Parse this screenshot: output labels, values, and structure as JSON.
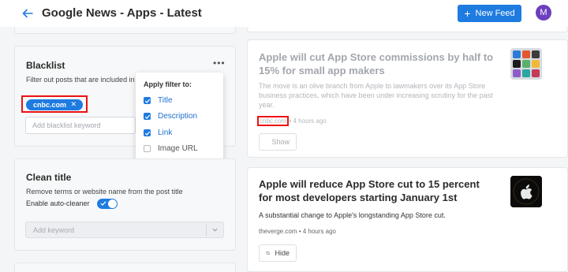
{
  "header": {
    "title": "Google News - Apps - Latest",
    "new_feed_label": "New Feed",
    "avatar_initial": "M",
    "accent_color": "#1e7be0"
  },
  "blacklist": {
    "title": "Blacklist",
    "description": "Filter out posts that are included in",
    "chip_label": "cnbc.com",
    "input_placeholder": "Add blacklist keyword",
    "apply_filter": {
      "title": "Apply filter to:",
      "options": [
        {
          "label": "Title",
          "checked": true
        },
        {
          "label": "Description",
          "checked": true
        },
        {
          "label": "Link",
          "checked": true
        },
        {
          "label": "Image URL",
          "checked": false
        }
      ]
    }
  },
  "clean_title": {
    "title": "Clean title",
    "description": "Remove terms or website name from the post title",
    "auto_cleaner_label": "Enable auto-cleaner",
    "auto_cleaner_enabled": true,
    "keyword_placeholder": "Add keyword"
  },
  "feed": {
    "items": [
      {
        "title": "Apple will cut App Store commissions by half to 15% for small app makers",
        "description": "The move is an olive branch from Apple to lawmakers over its App Store business practices, which have been under increasing scrutiny for the past year.",
        "source": "cnbc.com",
        "time": "4 hours ago",
        "button_label": "Show",
        "hidden": true
      },
      {
        "title": "Apple will reduce App Store cut to 15 percent for most developers starting January 1st",
        "description": "A substantial change to Apple's longstanding App Store cut.",
        "source": "theverge.com",
        "time": "4 hours ago",
        "button_label": "Hide",
        "hidden": false
      }
    ]
  }
}
